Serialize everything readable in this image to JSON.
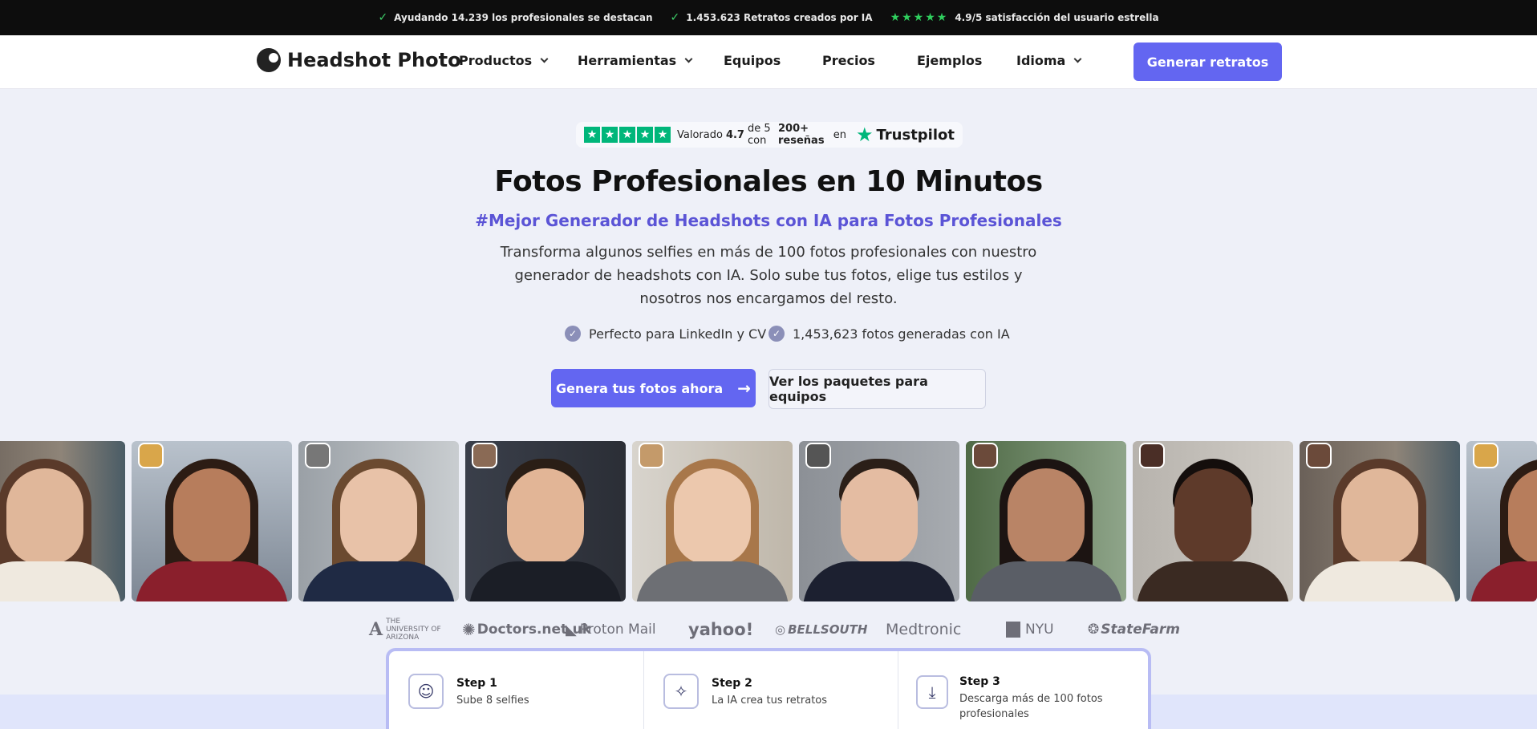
{
  "topbar": {
    "item1": "Ayudando 14.239 los profesionales se destacan",
    "item2": "1.453.623 Retratos creados por IA",
    "item3": "4.9/5 satisfacción del usuario estrella",
    "stars": "★★★★★"
  },
  "nav": {
    "logo": "Headshot Photo",
    "items": [
      "Productos",
      "Herramientas",
      "Equipos",
      "Precios",
      "Ejemplos",
      "Idioma"
    ],
    "cta": "Generar retratos"
  },
  "trustpilot": {
    "pre": "Valorado",
    "rating": "4.7",
    "mid": "de 5 con",
    "reviews": "200+ reseñas",
    "post": "en",
    "brand": "Trustpilot"
  },
  "hero": {
    "title": "Fotos Profesionales en 10 Minutos",
    "subtitle": "#Mejor Generador de Headshots con IA para Fotos Profesionales",
    "description": "Transforma algunos selfies en más de 100 fotos profesionales con nuestro generador de headshots con IA. Solo sube tus fotos, elige tus estilos y nosotros nos encargamos del resto.",
    "feature1": "Perfecto para LinkedIn y CV",
    "feature2": "1,453,623 fotos generadas con IA",
    "primary_cta": "Genera tus fotos ahora",
    "secondary_cta": "Ver los paquetes para equipos"
  },
  "logos": [
    "THE UNIVERSITY OF ARIZONA",
    "Doctors.net.uk",
    "Proton Mail",
    "yahoo!",
    "BELLSOUTH",
    "Medtronic",
    "NYU",
    "StateFarm"
  ],
  "steps": [
    {
      "title": "Step 1",
      "desc": "Sube 8 selfies"
    },
    {
      "title": "Step 2",
      "desc": "La IA crea tus retratos"
    },
    {
      "title": "Step 3",
      "desc": "Descarga más de 100 fotos profesionales"
    }
  ],
  "colors": {
    "accent": "#6366f1",
    "subtitle": "#5b54d6",
    "trustpilot_green": "#00b67a"
  }
}
